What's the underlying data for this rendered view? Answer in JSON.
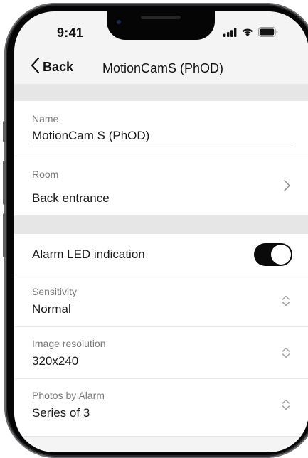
{
  "status_bar": {
    "time": "9:41",
    "icons": [
      "cellular-signal-icon",
      "wifi-icon",
      "battery-icon"
    ]
  },
  "nav": {
    "back_label": "Back",
    "title": "MotionCamS (PhOD)"
  },
  "fields": {
    "name": {
      "label": "Name",
      "value": "MotionCam S (PhOD)"
    },
    "room": {
      "label": "Room",
      "value": "Back entrance"
    }
  },
  "settings": {
    "alarm_led": {
      "label": "Alarm LED indication",
      "enabled": true
    },
    "sensitivity": {
      "label": "Sensitivity",
      "value": "Normal"
    },
    "image_resolution": {
      "label": "Image resolution",
      "value": "320x240"
    },
    "photos_by_alarm": {
      "label": "Photos by Alarm",
      "value": "Series of 3"
    }
  },
  "colors": {
    "toggle_on": "#0a0a0a",
    "section_separator": "#e6e6e6",
    "screen_background": "#f4f4f4",
    "phone_frame": "#2a2a2c"
  }
}
